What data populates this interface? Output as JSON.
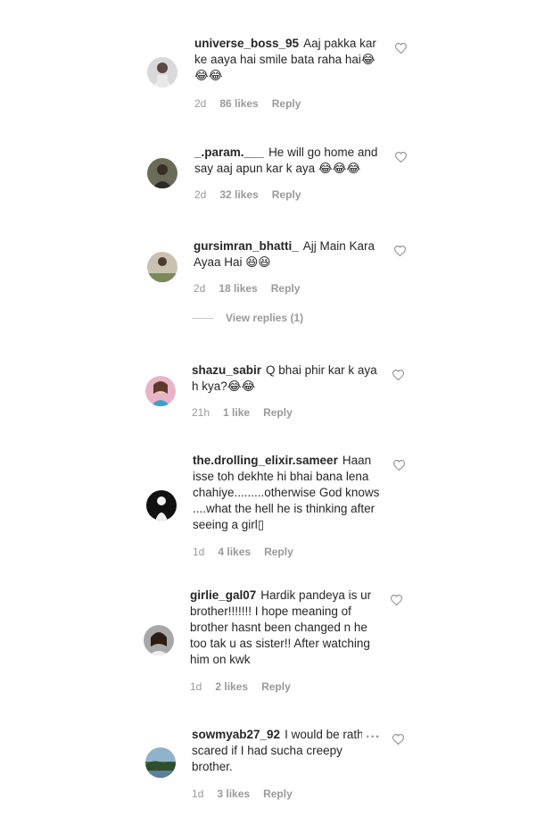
{
  "comments": [
    {
      "username": "universe_boss_95",
      "text": "Aaj pakka kar ke aaya hai smile bata raha hai😂😂😂",
      "time": "2d",
      "likes": "86 likes",
      "reply": "Reply"
    },
    {
      "username": "_.param.___",
      "text": "He will go home and say aaj apun kar k aya 😂😂😂",
      "time": "2d",
      "likes": "32 likes",
      "reply": "Reply"
    },
    {
      "username": "gursimran_bhatti_",
      "text": "Ajj Main Kara Ayaa Hai 😆😆",
      "time": "2d",
      "likes": "18 likes",
      "reply": "Reply",
      "view_replies": "View replies (1)"
    },
    {
      "username": "shazu_sabir",
      "text": "Q bhai phir kar k aya h kya?😂😂",
      "time": "21h",
      "likes": "1 like",
      "reply": "Reply"
    },
    {
      "username": "the.drolling_elixir.sameer",
      "text": "Haan isse toh dekhte hi bhai bana lena chahiye.........otherwise God knows ....what the hell he is thinking after seeing a girl▯",
      "time": "1d",
      "likes": "4 likes",
      "reply": "Reply"
    },
    {
      "username": "girlie_gal07",
      "text": "Hardik pandeya is ur brother!!!!!!! I hope meaning of brother hasnt been changed n he too tak u as sister!! After watching him on kwk",
      "time": "1d",
      "likes": "2 likes",
      "reply": "Reply"
    },
    {
      "username": "sowmyab27_92",
      "text": "I would be rather scared if I had sucha creepy brother.",
      "time": "1d",
      "likes": "3 likes",
      "reply": "Reply",
      "more": "..."
    }
  ],
  "colors": {
    "text": "#262626",
    "muted": "#999999"
  },
  "icons": {
    "like": "heart-outline-icon",
    "more": "more-options-icon"
  }
}
